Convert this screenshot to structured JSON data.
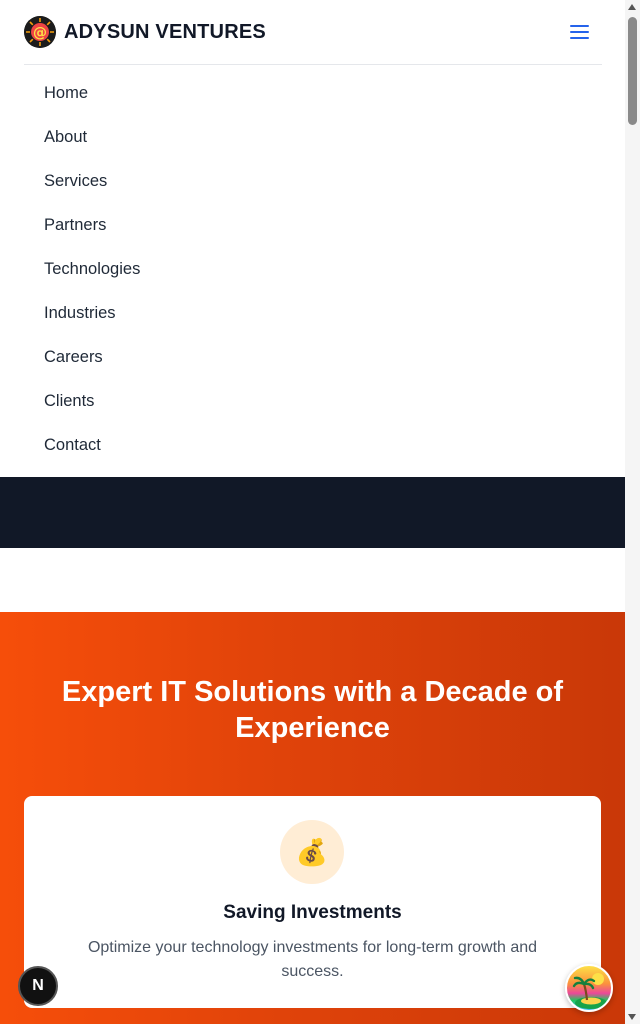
{
  "brand": {
    "name": "ADYSUN VENTURES",
    "logo_icon": "at-sign-sun-logo"
  },
  "header": {
    "menu_icon": "hamburger-menu-icon"
  },
  "nav": {
    "items": [
      {
        "label": "Home"
      },
      {
        "label": "About"
      },
      {
        "label": "Services"
      },
      {
        "label": "Partners"
      },
      {
        "label": "Technologies"
      },
      {
        "label": "Industries"
      },
      {
        "label": "Careers"
      },
      {
        "label": "Clients"
      },
      {
        "label": "Contact"
      }
    ]
  },
  "hero": {
    "title": "Expert IT Solutions with a Decade of Experience",
    "card": {
      "icon": "💰",
      "title": "Saving Investments",
      "text": "Optimize your technology investments for long-term growth and success."
    }
  },
  "floating": {
    "next_badge": "N",
    "chat_icon": "beach-island-chat-icon"
  },
  "colors": {
    "accent": "#2563eb",
    "dark_band": "#111827",
    "orange_start": "#f64e0a",
    "orange_end": "#c93808",
    "icon_bg": "#ffedd5"
  }
}
